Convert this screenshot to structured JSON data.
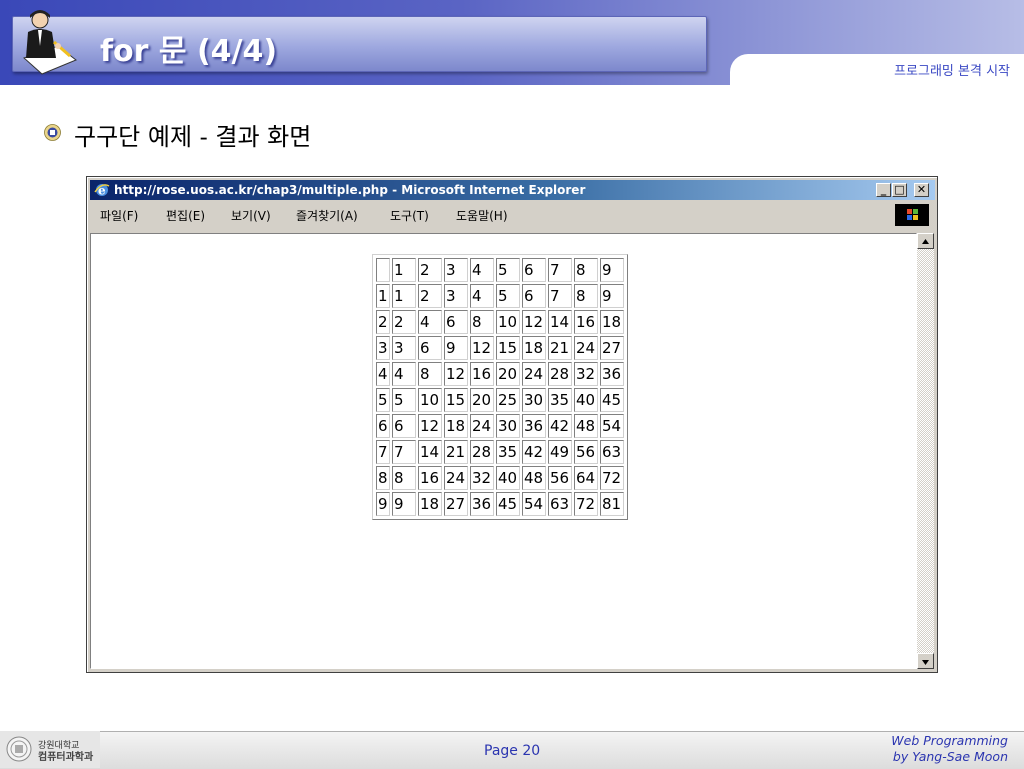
{
  "slide": {
    "title": "for 문 (4/4)",
    "header_tab": "프로그래밍 본격 시작",
    "bullet": "구구단 예제 - 결과 화면"
  },
  "browser": {
    "window_title": "http://rose.uos.ac.kr/chap3/multiple.php - Microsoft Internet Explorer",
    "controls": {
      "minimize": "_",
      "maximize": "□",
      "close": "✕"
    },
    "menu": [
      {
        "label": "파일(F)"
      },
      {
        "label": "편집(E)"
      },
      {
        "label": "보기(V)"
      },
      {
        "label": "즐겨찾기(A)"
      },
      {
        "label": "도구(T)"
      },
      {
        "label": "도움말(H)"
      }
    ]
  },
  "table": {
    "rows": [
      [
        "",
        "1",
        "2",
        "3",
        "4",
        "5",
        "6",
        "7",
        "8",
        "9"
      ],
      [
        "1",
        "1",
        "2",
        "3",
        "4",
        "5",
        "6",
        "7",
        "8",
        "9"
      ],
      [
        "2",
        "2",
        "4",
        "6",
        "8",
        "10",
        "12",
        "14",
        "16",
        "18"
      ],
      [
        "3",
        "3",
        "6",
        "9",
        "12",
        "15",
        "18",
        "21",
        "24",
        "27"
      ],
      [
        "4",
        "4",
        "8",
        "12",
        "16",
        "20",
        "24",
        "28",
        "32",
        "36"
      ],
      [
        "5",
        "5",
        "10",
        "15",
        "20",
        "25",
        "30",
        "35",
        "40",
        "45"
      ],
      [
        "6",
        "6",
        "12",
        "18",
        "24",
        "30",
        "36",
        "42",
        "48",
        "54"
      ],
      [
        "7",
        "7",
        "14",
        "21",
        "28",
        "35",
        "42",
        "49",
        "56",
        "63"
      ],
      [
        "8",
        "8",
        "16",
        "24",
        "32",
        "40",
        "48",
        "56",
        "64",
        "72"
      ],
      [
        "9",
        "9",
        "18",
        "27",
        "36",
        "45",
        "54",
        "63",
        "72",
        "81"
      ]
    ]
  },
  "footer": {
    "dept_line1": "강원대학교",
    "dept_line2": "컴퓨터과학과",
    "page": "Page 20",
    "credit_line1": "Web Programming",
    "credit_line2": "by Yang-Sae Moon"
  },
  "icons": {
    "logo": "businessman-writing-icon",
    "bullet": "university-emblem-icon",
    "browser": "internet-explorer-icon",
    "windows": "windows-logo-icon",
    "seal": "university-seal-icon"
  },
  "colors": {
    "header_blue": "#3a48b8",
    "title_bar": "#9ea8df",
    "accent_text": "#2b35b0",
    "ie_titlebar": "#0a246a",
    "window_gray": "#d4d0c8"
  }
}
